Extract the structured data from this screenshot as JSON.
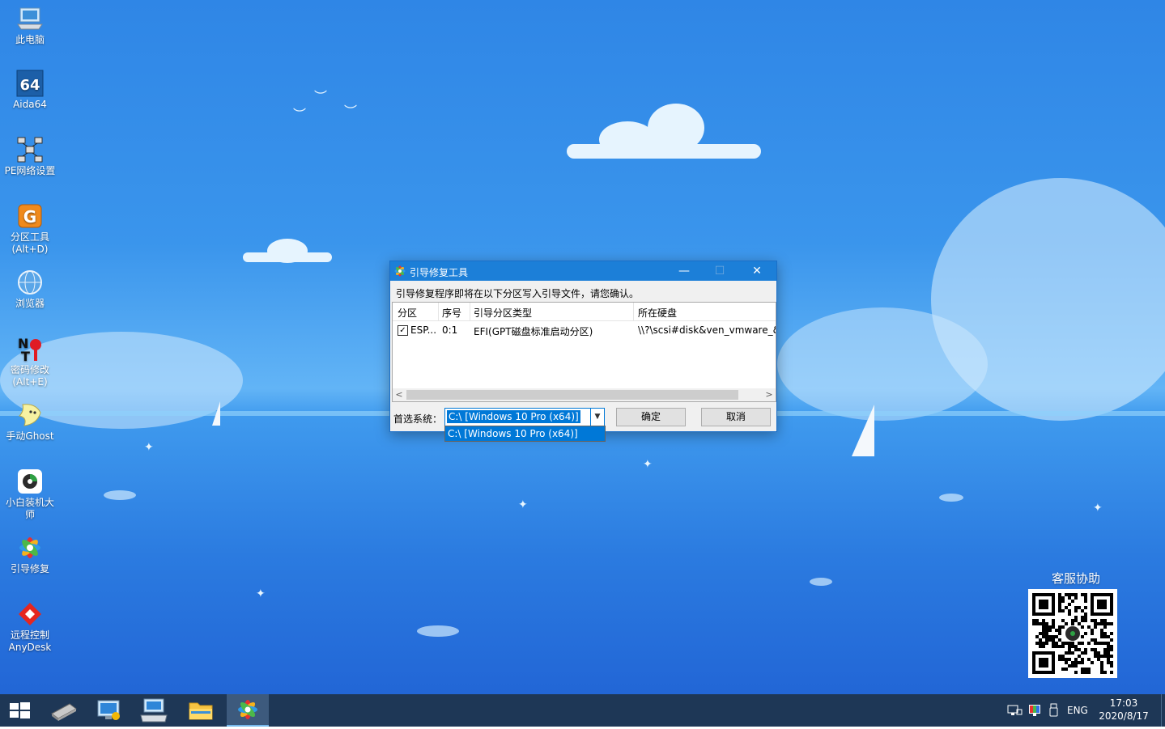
{
  "desktop": {
    "icons": [
      {
        "label": "此电脑",
        "icon": "computer-icon"
      },
      {
        "label": "Aida64",
        "icon": "aida64-icon"
      },
      {
        "label": "PE网络设置",
        "icon": "network-icon"
      },
      {
        "label": "分区工具",
        "label2": "(Alt+D)",
        "icon": "partition-tool-icon"
      },
      {
        "label": "浏览器",
        "icon": "browser-icon"
      },
      {
        "label": "密码修改",
        "label2": "(Alt+E)",
        "icon": "password-icon"
      },
      {
        "label": "手动Ghost",
        "icon": "ghost-icon"
      },
      {
        "label": "小白装机大",
        "label2": "师",
        "icon": "installer-icon"
      },
      {
        "label": "引导修复",
        "icon": "boot-repair-icon"
      },
      {
        "label": "远程控制",
        "label2": "AnyDesk",
        "icon": "anydesk-icon"
      }
    ],
    "qr_title": "客服协助"
  },
  "dialog": {
    "title": "引导修复工具",
    "subtitle": "引导修复程序即将在以下分区写入引导文件，请您确认。",
    "columns": [
      "分区",
      "序号",
      "引导分区类型",
      "所在硬盘"
    ],
    "rows": [
      {
        "checked": true,
        "partition": "ESP...",
        "index": "0:1",
        "type": "EFI(GPT磁盘标准启动分区)",
        "disk": "\\\\?\\scsi#disk&ven_vmware_&"
      }
    ],
    "preferred_label": "首选系统：",
    "combo_value": "C:\\ [Windows 10 Pro (x64)]",
    "combo_options": [
      "C:\\ [Windows 10 Pro (x64)]"
    ],
    "ok_label": "确定",
    "cancel_label": "取消",
    "minimize_glyph": "—",
    "maximize_glyph": "☐",
    "close_glyph": "✕",
    "check_glyph": "✓"
  },
  "taskbar": {
    "lang": "ENG",
    "time": "17:03",
    "date": "2020/8/17"
  },
  "colors": {
    "titlebar": "#1c7fd8",
    "taskbar": "#1e3756",
    "selection": "#0078d7"
  }
}
